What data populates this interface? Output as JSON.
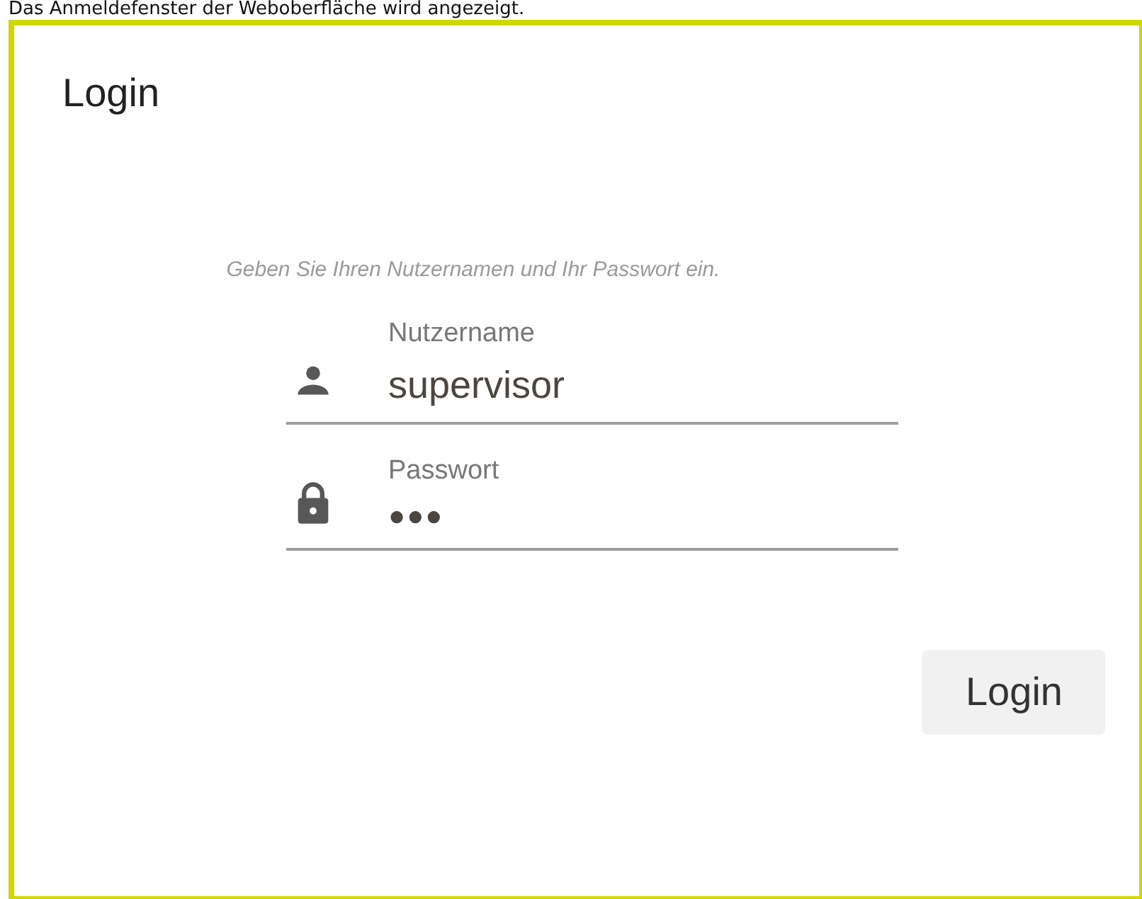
{
  "caption": "Das Anmeldefenster der Weboberfläche wird angezeigt.",
  "dialog": {
    "title": "Login",
    "instruction": "Geben Sie Ihren Nutzernamen und Ihr Passwort ein.",
    "fields": [
      {
        "kind": "user",
        "label": "Nutzername",
        "value": "supervisor"
      },
      {
        "kind": "password",
        "label": "Passwort",
        "value": "●●●"
      }
    ],
    "button": "Login"
  }
}
